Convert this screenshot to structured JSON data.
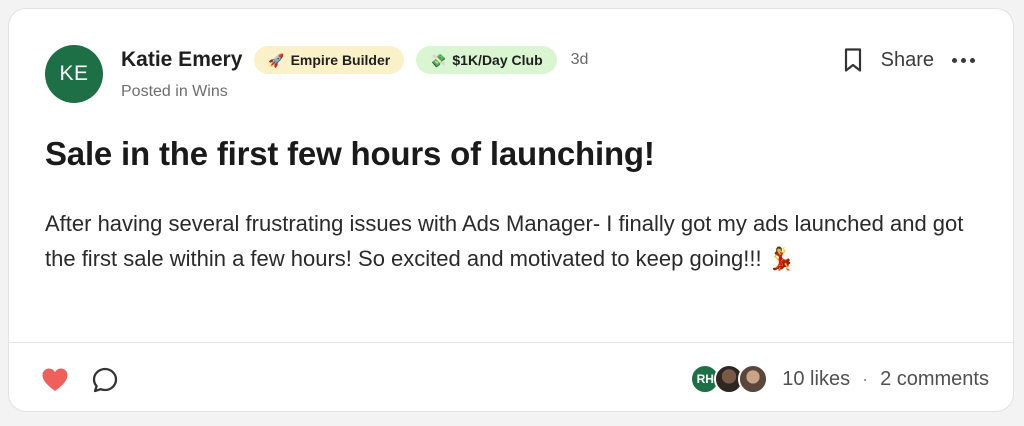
{
  "post": {
    "author": {
      "initials": "KE",
      "name": "Katie Emery",
      "avatar_color": "#1d6f45"
    },
    "badges": [
      {
        "icon": "rocket-icon",
        "glyph": "🚀",
        "label": "Empire Builder",
        "color": "#fbf1c9"
      },
      {
        "icon": "money-icon",
        "glyph": "💸",
        "label": "$1K/Day Club",
        "color": "#d9f5d2"
      }
    ],
    "age": "3d",
    "category_line": "Posted in Wins",
    "title": "Sale in the first few hours of launching!",
    "body": "After having several frustrating issues with Ads Manager- I finally got my ads launched and got the first sale within a few hours! So excited and motivated to keep going!!! 💃",
    "actions": {
      "share_label": "Share",
      "bookmark_icon": "bookmark-icon",
      "more_icon": "more-icon"
    },
    "footer": {
      "like_icon": "heart-icon",
      "like_color": "#f0605a",
      "comment_icon": "comment-icon",
      "liker_initials": "RH",
      "likes_text": "10 likes",
      "separator": "·",
      "comments_text": "2 comments"
    }
  }
}
